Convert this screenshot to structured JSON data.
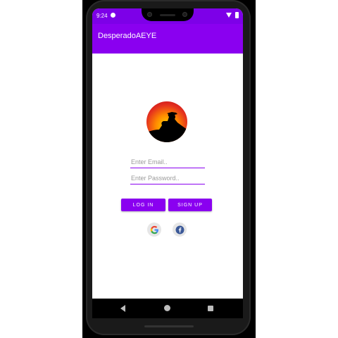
{
  "status_bar": {
    "time": "9:24"
  },
  "app_bar": {
    "title": "DesperadoAEYE"
  },
  "login_form": {
    "email_placeholder": "Enter Email..",
    "password_placeholder": "Enter Password..",
    "login_label": "LOG IN",
    "signup_label": "SIGN UP"
  },
  "social": {
    "google": "google-icon",
    "facebook": "facebook-icon"
  },
  "colors": {
    "primary": "#8a00f0",
    "status_bar": "#7d00e8"
  }
}
